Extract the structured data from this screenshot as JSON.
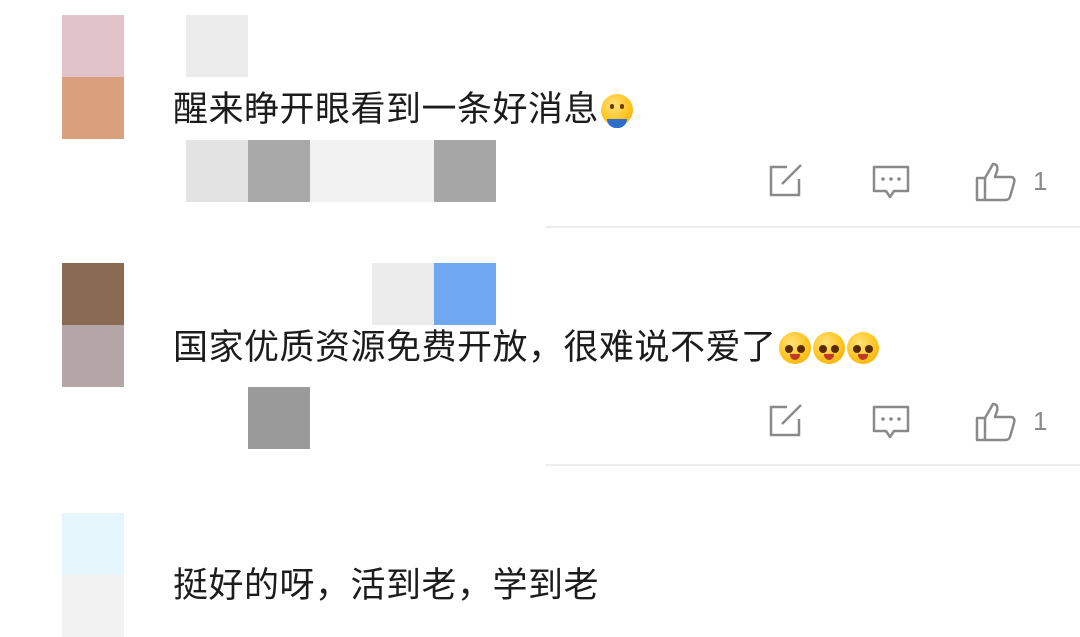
{
  "comments": [
    {
      "text": "醒来睁开眼看到一条好消息",
      "emojis": [
        "smile-hug-icon"
      ],
      "like_count": "1"
    },
    {
      "text": "国家优质资源免费开放，很难说不爱了",
      "emojis": [
        "heart-eyes-icon",
        "heart-eyes-icon",
        "heart-eyes-icon"
      ],
      "like_count": "1"
    },
    {
      "text": "挺好的呀，活到老，学到老",
      "emojis": [],
      "like_count": ""
    }
  ],
  "icons": {
    "share": "share-icon",
    "reply": "comment-icon",
    "like": "thumbs-up-icon"
  },
  "colors": {
    "icon": "#8a8a8a",
    "text": "#1c1c1c",
    "divider": "#eeeeee"
  }
}
